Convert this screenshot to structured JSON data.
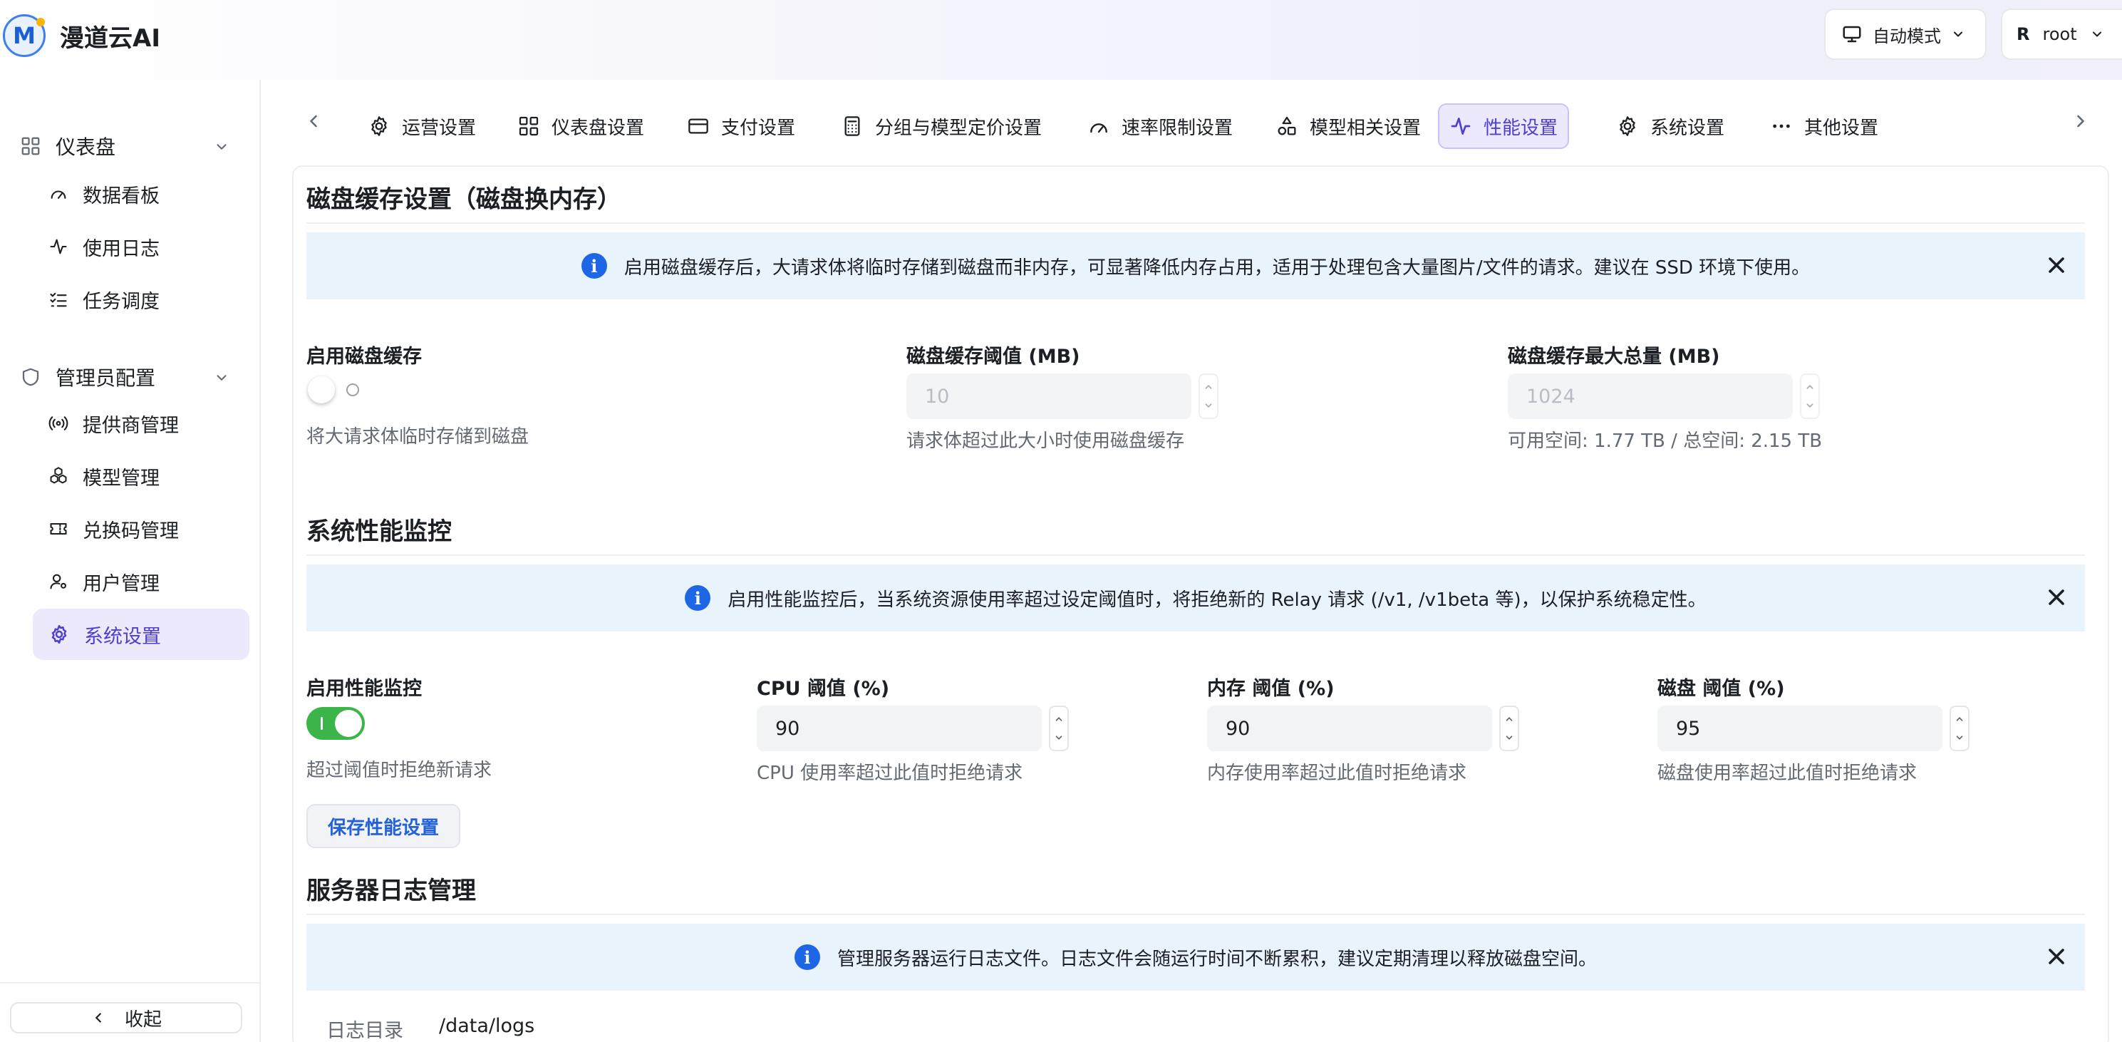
{
  "app": {
    "title": "漫道云AI",
    "logo_letter": "M"
  },
  "header": {
    "mode_label": "自动模式",
    "user_initial": "R",
    "user_name": "root"
  },
  "sidebar": {
    "groups": [
      {
        "label": "仪表盘",
        "items": [
          {
            "label": "数据看板",
            "icon": "gauge-icon"
          },
          {
            "label": "使用日志",
            "icon": "activity-icon"
          },
          {
            "label": "任务调度",
            "icon": "list-check-icon"
          }
        ]
      },
      {
        "label": "管理员配置",
        "items": [
          {
            "label": "提供商管理",
            "icon": "broadcast-icon"
          },
          {
            "label": "模型管理",
            "icon": "cubes-icon"
          },
          {
            "label": "兑换码管理",
            "icon": "ticket-icon"
          },
          {
            "label": "用户管理",
            "icon": "user-gear-icon"
          },
          {
            "label": "系统设置",
            "icon": "gear-icon",
            "active": true
          }
        ]
      }
    ],
    "collapse_label": "收起"
  },
  "tabs": [
    {
      "label": "运营设置",
      "icon": "gear-icon"
    },
    {
      "label": "仪表盘设置",
      "icon": "grid-icon"
    },
    {
      "label": "支付设置",
      "icon": "card-icon"
    },
    {
      "label": "分组与模型定价设置",
      "icon": "calculator-icon"
    },
    {
      "label": "速率限制设置",
      "icon": "gauge-icon"
    },
    {
      "label": "模型相关设置",
      "icon": "shapes-icon"
    },
    {
      "label": "性能设置",
      "icon": "activity-icon",
      "active": true
    },
    {
      "label": "系统设置",
      "icon": "gear-icon"
    },
    {
      "label": "其他设置",
      "icon": "more-icon"
    }
  ],
  "disk_cache": {
    "title": "磁盘缓存设置（磁盘换内存）",
    "banner": "启用磁盘缓存后，大请求体将临时存储到磁盘而非内存，可显著降低内存占用，适用于处理包含大量图片/文件的请求。建议在 SSD 环境下使用。",
    "enable_label": "启用磁盘缓存",
    "enable_help": "将大请求体临时存储到磁盘",
    "enabled": false,
    "threshold_label": "磁盘缓存阈值 (MB)",
    "threshold_value": "10",
    "threshold_help": "请求体超过此大小时使用磁盘缓存",
    "max_label": "磁盘缓存最大总量 (MB)",
    "max_value": "1024",
    "max_help": "可用空间: 1.77 TB / 总空间: 2.15 TB"
  },
  "perf_monitor": {
    "title": "系统性能监控",
    "banner": "启用性能监控后，当系统资源使用率超过设定阈值时，将拒绝新的 Relay 请求 (/v1, /v1beta 等)，以保护系统稳定性。",
    "enable_label": "启用性能监控",
    "enable_help": "超过阈值时拒绝新请求",
    "enabled": true,
    "cpu_label": "CPU 阈值 (%)",
    "cpu_value": "90",
    "cpu_help": "CPU 使用率超过此值时拒绝请求",
    "mem_label": "内存 阈值 (%)",
    "mem_value": "90",
    "mem_help": "内存使用率超过此值时拒绝请求",
    "disk_label": "磁盘 阈值 (%)",
    "disk_value": "95",
    "disk_help": "磁盘使用率超过此值时拒绝请求",
    "save_label": "保存性能设置"
  },
  "server_logs": {
    "title": "服务器日志管理",
    "banner": "管理服务器运行日志文件。日志文件会随运行时间不断累积，建议定期清理以释放磁盘空间。",
    "dir_label": "日志目录",
    "dir_value": "/data/logs"
  },
  "colors": {
    "accent": "#4d3fd0",
    "active_bg": "#ece9fd",
    "info_blue": "#1d67e6",
    "banner_bg": "#e9f3fc",
    "switch_on": "#3bb54a",
    "link_blue": "#2361d8"
  }
}
